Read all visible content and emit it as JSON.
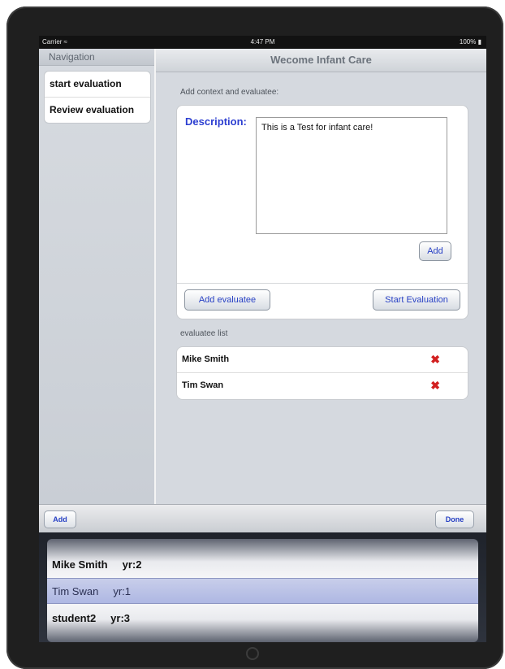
{
  "status_bar": {
    "carrier": "Carrier",
    "wifi_icon": "wifi-icon",
    "time": "4:47 PM",
    "battery": "100%"
  },
  "navigation": {
    "title": "Navigation",
    "items": [
      {
        "label": "start evaluation"
      },
      {
        "label": "Review evaluation"
      }
    ]
  },
  "detail": {
    "title": "Wecome Infant Care",
    "context_header": "Add context and evaluatee:",
    "description_label": "Description:",
    "description_value": "This is a Test for infant care!",
    "add_button": "Add",
    "add_evaluatee_button": "Add evaluatee",
    "start_evaluation_button": "Start Evaluation",
    "evaluatee_list_header": "evaluatee list",
    "evaluatees": [
      {
        "name": "Mike Smith",
        "delete_icon": "delete-icon"
      },
      {
        "name": "Tim Swan",
        "delete_icon": "delete-icon"
      }
    ]
  },
  "toolbar": {
    "add_label": "Add",
    "done_label": "Done"
  },
  "picker": {
    "rows": [
      {
        "name": "Mike Smith",
        "year": "yr:2",
        "selected": false
      },
      {
        "name": "Tim Swan",
        "year": "yr:1",
        "selected": true
      },
      {
        "name": "student2",
        "year": "yr:3",
        "selected": false
      }
    ]
  },
  "colors": {
    "accent_blue": "#2841c4",
    "delete_red": "#d22020",
    "selection": "#b7bfe6"
  }
}
